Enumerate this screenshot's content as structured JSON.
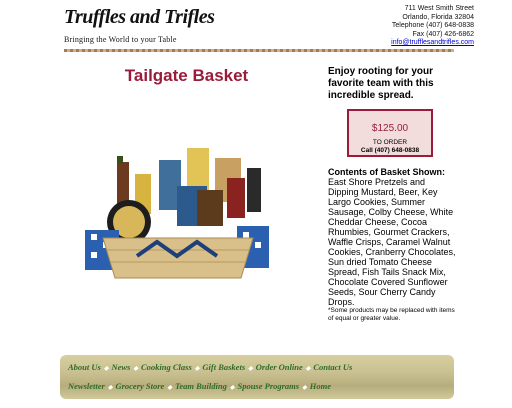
{
  "header": {
    "logo_script": "Truffles and Trifles",
    "logo_tagline": "Bringing the World to your Table",
    "address_lines": [
      "711 West Smith Street",
      "Orlando, Florida 32804",
      "Telephone (407) 648-0838",
      "Fax (407) 426-6862"
    ],
    "email": "info@trufflesandtrifles.com"
  },
  "product": {
    "title": "Tailgate Basket",
    "intro": "Enjoy rooting for your favorite team with this incredible spread.",
    "price": "$125.00",
    "order_text": "TO ORDER",
    "order_phone": "Call (407) 648-0838",
    "contents_heading": "Contents of Basket Shown:",
    "contents": "East Shore Pretzels and Dipping Mustard, Beer, Key Largo Cookies, Summer Sausage, Colby Cheese, White Cheddar Cheese, Cocoa Rhumbies, Gourmet Crackers, Waffle Crisps, Caramel Walnut Cookies, Cranberry Chocolates, Sun dried Tomato Cheese Spread, Fish Tails Snack Mix, Chocolate Covered Sunflower Seeds, Sour Cherry Candy Drops.",
    "note": "*Some products may be replaced with items of equal or greater value."
  },
  "nav": {
    "row1": [
      "About Us",
      "News",
      "Cooking Class",
      "Gift Baskets",
      "Order Online",
      "Contact Us"
    ],
    "row2": [
      "Newsletter",
      "Grocery Store",
      "Team Building",
      "Spouse Programs",
      "Home"
    ]
  },
  "colors": {
    "accent": "#9b1c3a",
    "nav_text": "#2f6b2a",
    "price_bg": "#f2dcdc"
  }
}
